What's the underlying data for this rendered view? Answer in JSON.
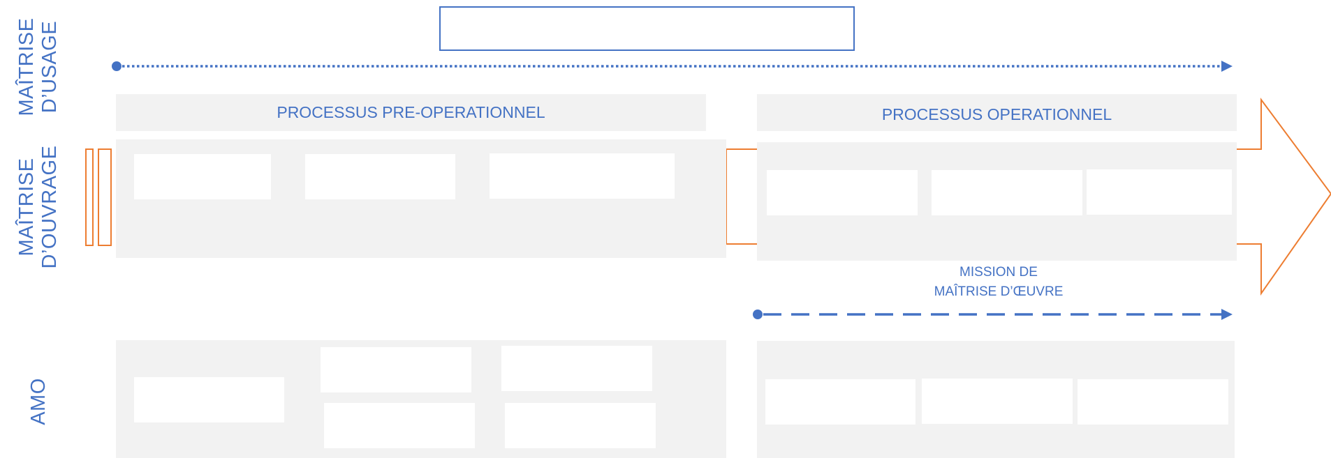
{
  "rows": {
    "maitrise_usage": "MAÎTRISE\nD’USAGE",
    "maitrise_ouvrage": "MAÎTRISE\nD’OUVRAGE",
    "amo": "AMO"
  },
  "phases": {
    "pre_operationnel": "PROCESSUS PRE-OPERATIONNEL",
    "operationnel": "PROCESSUS OPERATIONNEL"
  },
  "mission": "MISSION DE\nMAÎTRISE D’ŒUVRE",
  "colors": {
    "blue": "#4472c4",
    "orange": "#ed7d31",
    "panel": "#f2f2f2"
  }
}
